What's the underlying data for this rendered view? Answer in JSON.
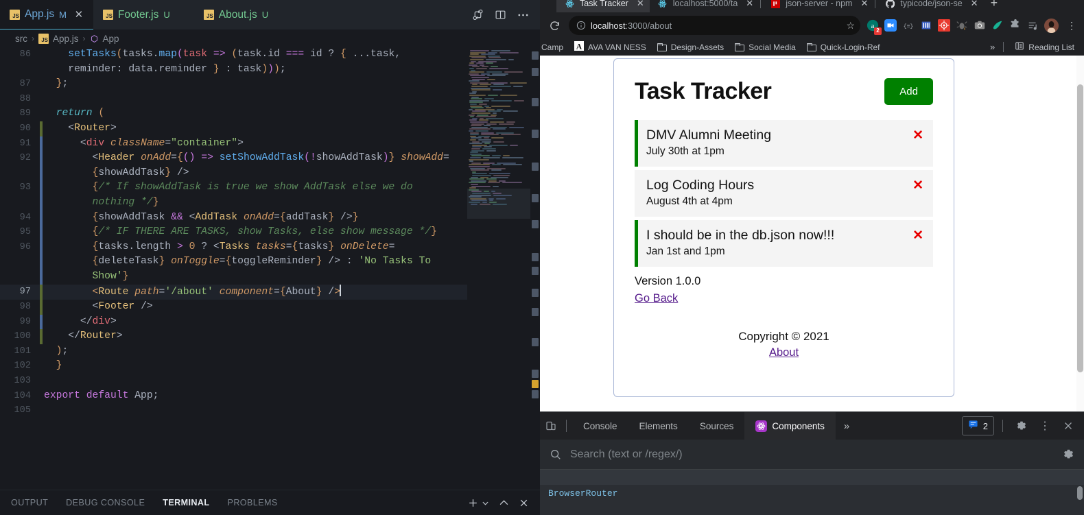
{
  "vscode": {
    "tabs": [
      {
        "name": "App.js",
        "git": "M",
        "state": "active",
        "icon": "js-file-icon"
      },
      {
        "name": "Footer.js",
        "git": "U",
        "state": "untracked",
        "icon": "js-file-icon"
      },
      {
        "name": "About.js",
        "git": "U",
        "state": "untracked",
        "icon": "js-file-icon"
      }
    ],
    "tab_actions": [
      "split-editor-source-control-icon",
      "split-editor-icon",
      "more-actions-icon"
    ],
    "breadcrumb": {
      "root": "src",
      "file": "App.js",
      "symbol": "App",
      "separator": "›"
    },
    "code_lines": [
      {
        "num": "86",
        "gutter": "",
        "html": "    <span class=\"fn\">setTasks</span><span class=\"par\">(</span>tasks.<span class=\"fn\">map</span><span class=\"par2\">(</span><span class=\"var\">task</span> <span class=\"op\">=&gt;</span> <span class=\"par\">(</span>task.id <span class=\"op\">===</span> id ? <span class=\"par\">{</span> ...task,"
      },
      {
        "num": "",
        "gutter": "",
        "html": "    reminder: data.reminder <span class=\"par\">}</span> : task<span class=\"par\">)</span><span class=\"par2\">)</span><span class=\"par\">)</span>;"
      },
      {
        "num": "87",
        "gutter": "",
        "html": "  <span class=\"par\">}</span>;"
      },
      {
        "num": "88",
        "gutter": "",
        "html": ""
      },
      {
        "num": "89",
        "gutter": "",
        "html": "  <span class=\"kf\">return</span> <span class=\"par\">(</span>"
      },
      {
        "num": "90",
        "gutter": "add",
        "html": "    <span class=\"pl\">&lt;</span><span class=\"tag\">Router</span><span class=\"pl\">&gt;</span>"
      },
      {
        "num": "91",
        "gutter": "mod",
        "html": "      <span class=\"pl\">&lt;</span><span class=\"tagl\">div</span> <span class=\"att\">className</span>=<span class=\"str\">\"container\"</span><span class=\"pl\">&gt;</span>"
      },
      {
        "num": "92",
        "gutter": "mod",
        "html": "        <span class=\"pl\">&lt;</span><span class=\"tag\">Header</span> <span class=\"att\">onAdd</span>=<span class=\"par\">{</span><span class=\"par2\">()</span> <span class=\"op\">=&gt;</span> <span class=\"fn\">setShowAddTask</span><span class=\"par2\">(</span><span class=\"op\">!</span>showAddTask<span class=\"par2\">)</span><span class=\"par\">}</span> <span class=\"att\">showAdd</span>="
      },
      {
        "num": "",
        "gutter": "mod",
        "html": "        <span class=\"par\">{</span>showAddTask<span class=\"par\">}</span> <span class=\"pl\">/&gt;</span>"
      },
      {
        "num": "93",
        "gutter": "mod",
        "html": "        <span class=\"par\">{</span><span class=\"cmt\">/* If showAddTask is true we show AddTask else we do</span>"
      },
      {
        "num": "",
        "gutter": "mod",
        "html": "        <span class=\"cmt\">nothing */</span><span class=\"par\">}</span>"
      },
      {
        "num": "94",
        "gutter": "mod",
        "html": "        <span class=\"par\">{</span>showAddTask <span class=\"op\">&amp;&amp;</span> <span class=\"pl\">&lt;</span><span class=\"tag\">AddTask</span> <span class=\"att\">onAdd</span>=<span class=\"par\">{</span>addTask<span class=\"par\">}</span> <span class=\"pl\">/&gt;</span><span class=\"par\">}</span>"
      },
      {
        "num": "95",
        "gutter": "mod",
        "html": "        <span class=\"par\">{</span><span class=\"cmt\">/* IF THERE ARE TASKS, show Tasks, else show message */</span><span class=\"par\">}</span>"
      },
      {
        "num": "96",
        "gutter": "mod",
        "html": "        <span class=\"par\">{</span>tasks.length <span class=\"op\">&gt;</span> <span class=\"num\">0</span> ? <span class=\"pl\">&lt;</span><span class=\"tag\">Tasks</span> <span class=\"att\">tasks</span>=<span class=\"par\">{</span>tasks<span class=\"par\">}</span> <span class=\"att\">onDelete</span>="
      },
      {
        "num": "",
        "gutter": "mod",
        "html": "        <span class=\"par\">{</span>deleteTask<span class=\"par\">}</span> <span class=\"att\">onToggle</span>=<span class=\"par\">{</span>toggleReminder<span class=\"par\">}</span> <span class=\"pl\">/&gt;</span> : <span class=\"str\">'No Tasks To</span>"
      },
      {
        "num": "",
        "gutter": "mod",
        "html": "        <span class=\"str\">Show'</span><span class=\"par\">}</span>"
      },
      {
        "num": "97",
        "gutter": "add",
        "html": "        <span class=\"par\">&lt;</span><span class=\"tag\">Route</span> <span class=\"att\">path</span>=<span class=\"str\">'/about'</span> <span class=\"att\">component</span>=<span class=\"par\">{</span>About<span class=\"par\">}</span> <span class=\"pl\">/</span><span class=\"par\">&gt;</span><span class=\"cur-caret\"></span>",
        "highlight": true,
        "current": true
      },
      {
        "num": "98",
        "gutter": "add",
        "html": "        <span class=\"pl\">&lt;</span><span class=\"tag\">Footer</span> <span class=\"pl\">/&gt;</span>"
      },
      {
        "num": "99",
        "gutter": "mod",
        "html": "      <span class=\"pl\">&lt;/</span><span class=\"tagl\">div</span><span class=\"pl\">&gt;</span>"
      },
      {
        "num": "100",
        "gutter": "add",
        "html": "    <span class=\"pl\">&lt;/</span><span class=\"tag\">Router</span><span class=\"pl\">&gt;</span>"
      },
      {
        "num": "101",
        "gutter": "",
        "html": "  <span class=\"par\">)</span>;"
      },
      {
        "num": "102",
        "gutter": "",
        "html": "  <span class=\"par\">}</span>"
      },
      {
        "num": "103",
        "gutter": "",
        "html": ""
      },
      {
        "num": "104",
        "gutter": "",
        "html": "<span class=\"k\">export</span> <span class=\"k\">default</span> App;"
      },
      {
        "num": "105",
        "gutter": "",
        "html": ""
      }
    ],
    "panel": {
      "tabs": [
        {
          "label": "OUTPUT",
          "active": false
        },
        {
          "label": "DEBUG CONSOLE",
          "active": false
        },
        {
          "label": "TERMINAL",
          "active": true
        },
        {
          "label": "PROBLEMS",
          "active": false
        }
      ],
      "actions": [
        "add-terminal-icon",
        "terminal-dropdown-icon",
        "maximize-panel-icon",
        "close-panel-icon"
      ]
    }
  },
  "chrome": {
    "tabs": [
      {
        "title": "Task Tracker",
        "favicon": "react-icon",
        "active": true
      },
      {
        "title": "localhost:5000/ta",
        "favicon": "react-icon",
        "active": false
      },
      {
        "title": "json-server - npm",
        "favicon": "npm-icon",
        "active": false
      },
      {
        "title": "typicode/json-se",
        "favicon": "github-icon",
        "active": false
      }
    ],
    "new_tab_label": "+",
    "toolbar": {
      "reload_icon": "reload-icon",
      "site_info_icon": "info-circle-icon",
      "url_host": "localhost",
      "url_path": ":3000/about",
      "star_icon": "bookmark-star-icon",
      "extensions": [
        {
          "name": "amazon-assistant-extension",
          "badge": "2"
        },
        {
          "name": "zoom-extension",
          "badge": ""
        },
        {
          "name": "equalizer-extension",
          "badge": ""
        },
        {
          "name": "barcode-extension",
          "badge": ""
        },
        {
          "name": "bug-report-extension",
          "badge": ""
        },
        {
          "name": "chrome-bug-extension",
          "badge": ""
        },
        {
          "name": "screenshot-camera-extension",
          "badge": ""
        },
        {
          "name": "grammarly-extension",
          "badge": ""
        },
        {
          "name": "extensions-puzzle-icon",
          "badge": ""
        },
        {
          "name": "reading-list-icon",
          "badge": ""
        }
      ],
      "profile_icon": "profile-avatar",
      "menu_icon": "three-dot-menu-icon"
    },
    "bookmarks": [
      {
        "label": "Camp",
        "icon": ""
      },
      {
        "label": "AVA VAN NESS",
        "icon": "ava-logo-icon"
      },
      {
        "label": "Design-Assets",
        "icon": "folder-icon"
      },
      {
        "label": "Social Media",
        "icon": "folder-icon"
      },
      {
        "label": "Quick-Login-Ref",
        "icon": "folder-icon"
      }
    ],
    "bookmarks_overflow": "»",
    "reading_list_label": "Reading List",
    "reading_list_icon": "reading-list-icon"
  },
  "page": {
    "title": "Task Tracker",
    "add_button": "Add",
    "tasks": [
      {
        "title": "DMV Alumni Meeting",
        "day": "July 30th at 1pm",
        "reminder": true,
        "delete_icon": "close-x-icon"
      },
      {
        "title": "Log Coding Hours",
        "day": "August 4th at 4pm",
        "reminder": false,
        "delete_icon": "close-x-icon"
      },
      {
        "title": "I should be in the db.json now!!!",
        "day": "Jan 1st and 1pm",
        "reminder": true,
        "delete_icon": "close-x-icon"
      }
    ],
    "about_version": "Version 1.0.0",
    "about_goback": "Go Back",
    "footer_copyright": "Copyright © 2021",
    "footer_about": "About",
    "accent_green": "#008000",
    "delete_red": "#e80000",
    "link_purple": "#551a8b",
    "card_border": "#a8b6d6"
  },
  "devtools": {
    "device_toggle_icon": "device-toolbar-icon",
    "tabs": [
      {
        "label": "Console",
        "active": false,
        "icon": ""
      },
      {
        "label": "Elements",
        "active": false,
        "icon": ""
      },
      {
        "label": "Sources",
        "active": false,
        "icon": ""
      },
      {
        "label": "Components",
        "active": true,
        "icon": "react-components-icon"
      }
    ],
    "more_tabs": "»",
    "message_count": "2",
    "message_icon": "message-badge-icon",
    "settings_icon": "gear-icon",
    "kebab_icon": "three-dot-menu-icon",
    "close_icon": "close-icon",
    "search_icon": "search-icon",
    "search_placeholder": "Search (text or /regex/)",
    "search_value": "",
    "search_settings_icon": "gear-icon",
    "tree_root": "BrowserRouter"
  }
}
